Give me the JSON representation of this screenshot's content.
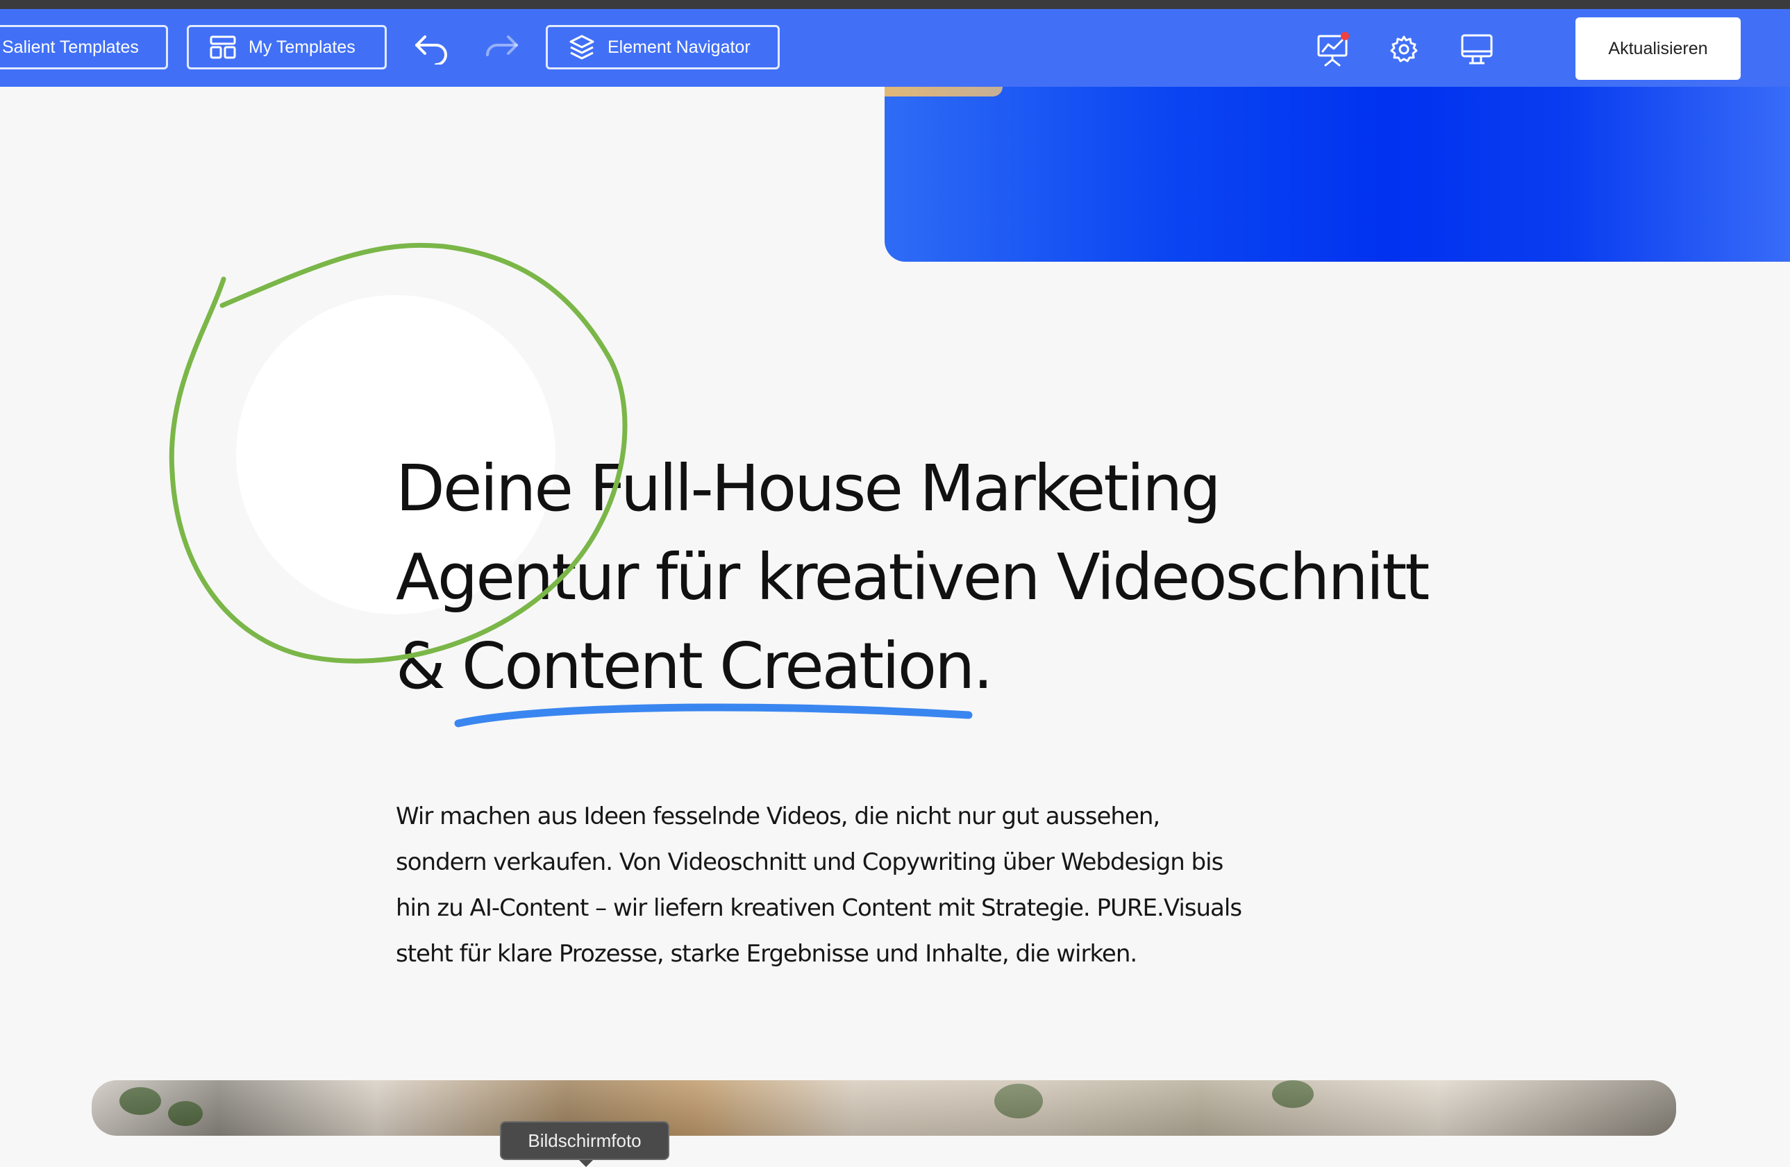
{
  "toolbar": {
    "salient_templates_label": "Salient Templates",
    "my_templates_label": "My Templates",
    "element_navigator_label": "Element Navigator",
    "update_label": "Aktualisieren",
    "accent_color": "#4170f7"
  },
  "hero": {
    "headline_lines": [
      "Deine Full-House Marketing",
      "Agentur für kreativen Videoschnitt",
      "& Content Creation."
    ],
    "body_lines": [
      "Wir machen aus Ideen fesselnde Videos, die nicht nur gut aussehen,",
      "sondern verkaufen. Von Videoschnitt und Copywriting über Webdesign bis",
      "hin zu AI-Content – wir liefern kreativen Content mit Strategie. PURE.Visuals",
      "steht für klare Prozesse, starke Ergebnisse und Inhalte, die wirken."
    ],
    "annotation_circle_color": "#7ab648",
    "underline_color": "#3a86f0"
  },
  "tooltip": {
    "label": "Bildschirmfoto"
  }
}
